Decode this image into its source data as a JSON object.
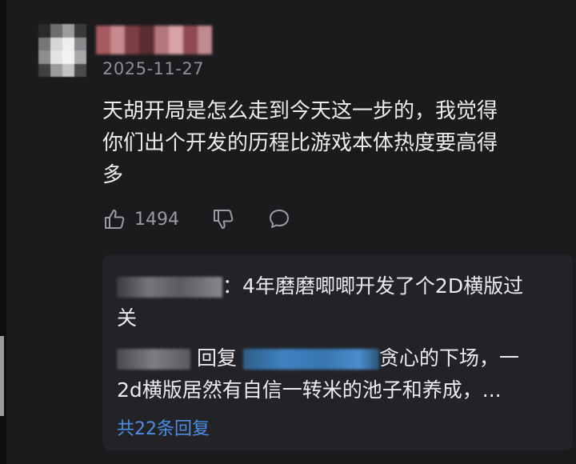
{
  "comment": {
    "date": "2025-11-27",
    "text_line1": "天胡开局是怎么走到今天这一步的，我觉得",
    "text_line2": "你们出个开发的历程比游戏本体热度要高得",
    "text_line3": "多",
    "like_count": "1494",
    "icons": {
      "like": "thumbs-up-icon",
      "dislike": "thumbs-down-icon",
      "reply": "speech-bubble-icon"
    }
  },
  "replies": [
    {
      "prefix": "：",
      "text_line1": "4年磨磨唧唧开发了个2D横版过",
      "text_line2": "关"
    },
    {
      "reply_word": "回复",
      "text_line1": "贪心的下场，一",
      "text_line2": "2d横版居然有自信一转米的池子和养成，..."
    }
  ],
  "more_replies_label": "共22条回复",
  "colors": {
    "background": "#1b1b1e",
    "reply_panel": "#232327",
    "link": "#4c8ee6",
    "muted_text": "#8d8f95"
  }
}
